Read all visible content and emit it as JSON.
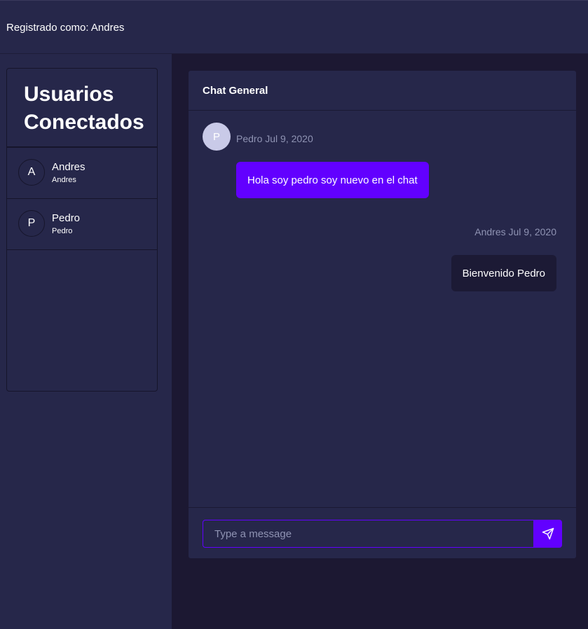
{
  "header": {
    "user_label": "Registrado como: Andres"
  },
  "sidebar": {
    "title": "Usuarios Conectados",
    "users": [
      {
        "initial": "A",
        "name": "Andres",
        "username": "Andres"
      },
      {
        "initial": "P",
        "name": "Pedro",
        "username": "Pedro"
      }
    ]
  },
  "chat": {
    "title": "Chat General",
    "messages": [
      {
        "avatar_initial": "P",
        "meta": "Pedro Jul 9, 2020",
        "text": "Hola soy pedro soy nuevo en el chat",
        "direction": "incoming"
      },
      {
        "meta": "Andres Jul 9, 2020",
        "text": "Bienvenido Pedro",
        "direction": "outgoing"
      }
    ],
    "composer": {
      "placeholder": "Type a message",
      "value": ""
    }
  },
  "colors": {
    "accent": "#6200ff",
    "surface": "#26274a",
    "background": "#1c1832",
    "muted_text": "#8f93b3"
  },
  "icons": {
    "send": "send-icon"
  }
}
